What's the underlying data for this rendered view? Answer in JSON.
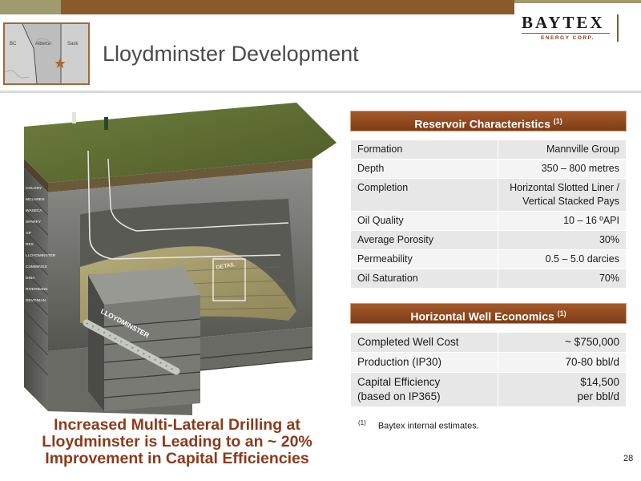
{
  "header": {
    "company_name": "BAYTEX",
    "company_sub": "ENERGY CORP.",
    "title": "Lloydminster Development"
  },
  "map": {
    "labels": [
      "BC",
      "Alberta",
      "Sask"
    ],
    "marker_icon": "star-icon"
  },
  "illustration": {
    "layer_labels": [
      "COLONY",
      "MCLAREN",
      "WASECA",
      "SPARKY",
      "GP",
      "REX",
      "LLOYDMINSTER",
      "CUMMINGS",
      "DINA",
      "RIVERBANK",
      "DEVONIAN"
    ],
    "detail_label": "DETAIL",
    "well_label": "LLOYDMINSTER"
  },
  "caption": {
    "line1": "Increased Multi-Lateral Drilling at",
    "line2": "Lloydminster is Leading to an ~ 20%",
    "line3": "Improvement in Capital Efficiencies"
  },
  "reservoir": {
    "title": "Reservoir Characteristics",
    "note": "(1)",
    "rows": [
      {
        "label": "Formation",
        "value": "Mannville Group"
      },
      {
        "label": "Depth",
        "value": "350 – 800 metres"
      },
      {
        "label": "Completion",
        "value": "Horizontal Slotted Liner /",
        "value2": "Vertical  Stacked Pays"
      },
      {
        "label": "Oil Quality",
        "value": "10 – 16 ºAPI"
      },
      {
        "label": "Average Porosity",
        "value": "30%"
      },
      {
        "label": "Permeability",
        "value": "0.5 – 5.0 darcies"
      },
      {
        "label": "Oil Saturation",
        "value": "70%"
      }
    ]
  },
  "economics": {
    "title": "Horizontal Well Economics",
    "note": "(1)",
    "rows": [
      {
        "label": "Completed Well Cost",
        "value": "~ $750,000"
      },
      {
        "label": "Production (IP30)",
        "value": "70-80 bbl/d"
      },
      {
        "label": "Capital Efficiency",
        "label2": "(based on IP365)",
        "value": "$14,500",
        "value2": "per bbl/d"
      }
    ]
  },
  "footnote": {
    "marker": "(1)",
    "text": "Baytex internal estimates."
  },
  "page_number": "28",
  "colors": {
    "brand_brown": "#8b5a2b",
    "olive": "#9e9a6c",
    "caption": "#8b3a1a"
  }
}
